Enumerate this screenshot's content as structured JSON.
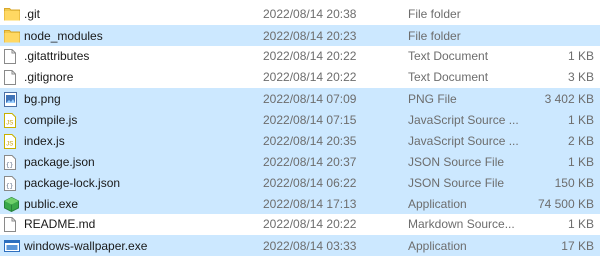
{
  "files": [
    {
      "name": ".git",
      "date": "2022/08/14 20:38",
      "type": "File folder",
      "size": "",
      "icon": "folder-icon",
      "selected": false
    },
    {
      "name": "node_modules",
      "date": "2022/08/14 20:23",
      "type": "File folder",
      "size": "",
      "icon": "folder-icon",
      "selected": true
    },
    {
      "name": ".gitattributes",
      "date": "2022/08/14 20:22",
      "type": "Text Document",
      "size": "1 KB",
      "icon": "text-document-icon",
      "selected": false
    },
    {
      "name": ".gitignore",
      "date": "2022/08/14 20:22",
      "type": "Text Document",
      "size": "3 KB",
      "icon": "text-document-icon",
      "selected": false
    },
    {
      "name": "bg.png",
      "date": "2022/08/14 07:09",
      "type": "PNG File",
      "size": "3 402 KB",
      "icon": "image-file-icon",
      "selected": true
    },
    {
      "name": "compile.js",
      "date": "2022/08/14 07:15",
      "type": "JavaScript Source ...",
      "size": "1 KB",
      "icon": "javascript-file-icon",
      "selected": true
    },
    {
      "name": "index.js",
      "date": "2022/08/14 20:35",
      "type": "JavaScript Source ...",
      "size": "2 KB",
      "icon": "javascript-file-icon",
      "selected": true
    },
    {
      "name": "package.json",
      "date": "2022/08/14 20:37",
      "type": "JSON Source File",
      "size": "1 KB",
      "icon": "json-file-icon",
      "selected": true
    },
    {
      "name": "package-lock.json",
      "date": "2022/08/14 06:22",
      "type": "JSON Source File",
      "size": "150 KB",
      "icon": "json-file-icon",
      "selected": true
    },
    {
      "name": "public.exe",
      "date": "2022/08/14 17:13",
      "type": "Application",
      "size": "74 500 KB",
      "icon": "application-cube-icon",
      "selected": true
    },
    {
      "name": "README.md",
      "date": "2022/08/14 20:22",
      "type": "Markdown Source...",
      "size": "1 KB",
      "icon": "text-document-icon",
      "selected": false
    },
    {
      "name": "windows-wallpaper.exe",
      "date": "2022/08/14 03:33",
      "type": "Application",
      "size": "17 KB",
      "icon": "application-window-icon",
      "selected": true
    }
  ],
  "colors": {
    "selection": "#cce8ff",
    "folder": "#f0c94d",
    "application_green": "#3aa849",
    "application_blue": "#2d6fbf"
  }
}
